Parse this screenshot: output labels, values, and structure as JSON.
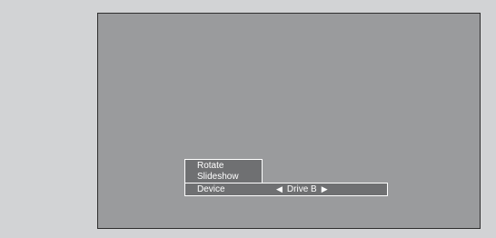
{
  "osd_menu": {
    "items": [
      {
        "label": "Rotate"
      },
      {
        "label": "Slideshow"
      },
      {
        "label": "Device",
        "value": "Drive B"
      }
    ],
    "left_arrow_icon": "left-arrow",
    "right_arrow_icon": "right-arrow",
    "colors": {
      "background": "#d2d3d5",
      "screen": "#9a9b9d",
      "menu_fill": "#6f7072",
      "menu_border": "#ffffff",
      "text": "#ffffff"
    }
  }
}
